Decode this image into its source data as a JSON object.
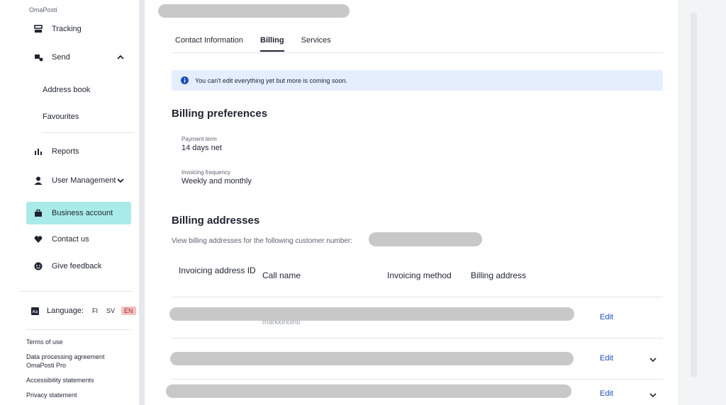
{
  "sidebar": {
    "brand": "OmaPosti",
    "nav": {
      "tracking": "Tracking",
      "send": "Send",
      "address_book": "Address book",
      "favourites": "Favourites",
      "reports": "Reports",
      "user_management": "User Management",
      "business_account": "Business account",
      "contact_us": "Contact us",
      "give_feedback": "Give feedback"
    },
    "language": {
      "label": "Language:",
      "options": [
        "FI",
        "SV",
        "EN"
      ],
      "selected": "EN"
    },
    "footer": {
      "terms": "Terms of use",
      "data_processing": "Data processing agreement OmaPosti Pro",
      "accessibility": "Accessibility statements",
      "privacy": "Privacy statement"
    }
  },
  "tabs": [
    "Contact Information",
    "Billing",
    "Services"
  ],
  "active_tab": "Billing",
  "notice": "You can't edit everything yet but more is coming soon.",
  "billing_preferences": {
    "title": "Billing preferences",
    "payment_term_label": "Payment term",
    "payment_term_value": "14 days net",
    "invoicing_frequency_label": "Invoicing frequency",
    "invoicing_frequency_value": "Weekly and monthly"
  },
  "billing_addresses": {
    "title": "Billing addresses",
    "helper": "View billing addresses for the following customer number:",
    "columns": [
      "Invoicing address ID",
      "Call name",
      "Invoicing method",
      "Billing address"
    ],
    "rows": [
      {
        "call_name_partial": "markkinointi",
        "action": "Edit"
      },
      {
        "call_name_partial": "",
        "action": "Edit"
      },
      {
        "call_name_partial": "",
        "action": "Edit"
      }
    ]
  },
  "colors": {
    "accent_active": "#a9ebe9",
    "link": "#1d4fb8",
    "notice_bg": "#e4eefc",
    "lang_selected_bg": "#f4c1bf"
  }
}
